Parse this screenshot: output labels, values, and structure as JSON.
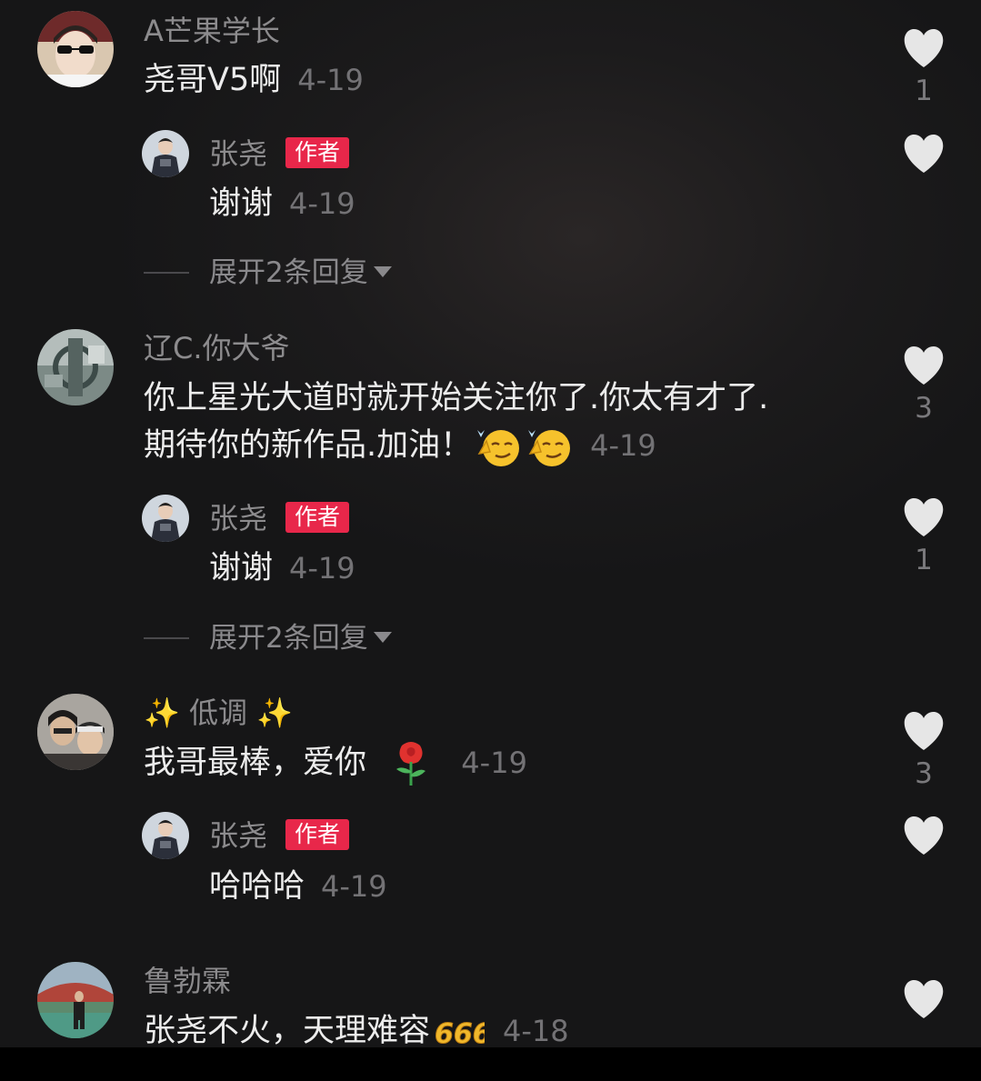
{
  "comments": [
    {
      "username": "A芒果学长",
      "text": "尧哥V5啊",
      "date": "4-19",
      "likes": "1",
      "reply": {
        "username": "张尧",
        "badge": "作者",
        "text": "谢谢",
        "date": "4-19"
      },
      "expand_label": "展开2条回复"
    },
    {
      "username": "辽C.你大爷",
      "text_line1": "你上星光大道时就开始关注你了.你太有才了.",
      "text_line2": "期待你的新作品.加油！",
      "date": "4-19",
      "likes": "3",
      "reply": {
        "username": "张尧",
        "badge": "作者",
        "text": "谢谢",
        "date": "4-19",
        "likes": "1"
      },
      "expand_label": "展开2条回复"
    },
    {
      "username": "低调",
      "text": "我哥最棒，爱你",
      "date": "4-19",
      "likes": "3",
      "reply": {
        "username": "张尧",
        "badge": "作者",
        "text": "哈哈哈",
        "date": "4-19"
      }
    },
    {
      "username": "鲁勃霖",
      "text": "张尧不火，天理难容",
      "date": "4-18"
    }
  ],
  "icons": {
    "like": "heart-icon",
    "expand": "caret-down-icon",
    "emoji_smirk": "smirking-face-emoji",
    "emoji_sparkles": "sparkles-emoji",
    "emoji_rose": "rose-emoji",
    "emoji_666": "666-emoji"
  },
  "colors": {
    "background": "#161617",
    "badge": "#e8274a",
    "username": "#8c8b8d",
    "comment_text": "#ececec",
    "date": "#737275",
    "heart": "#e6e6e6"
  }
}
